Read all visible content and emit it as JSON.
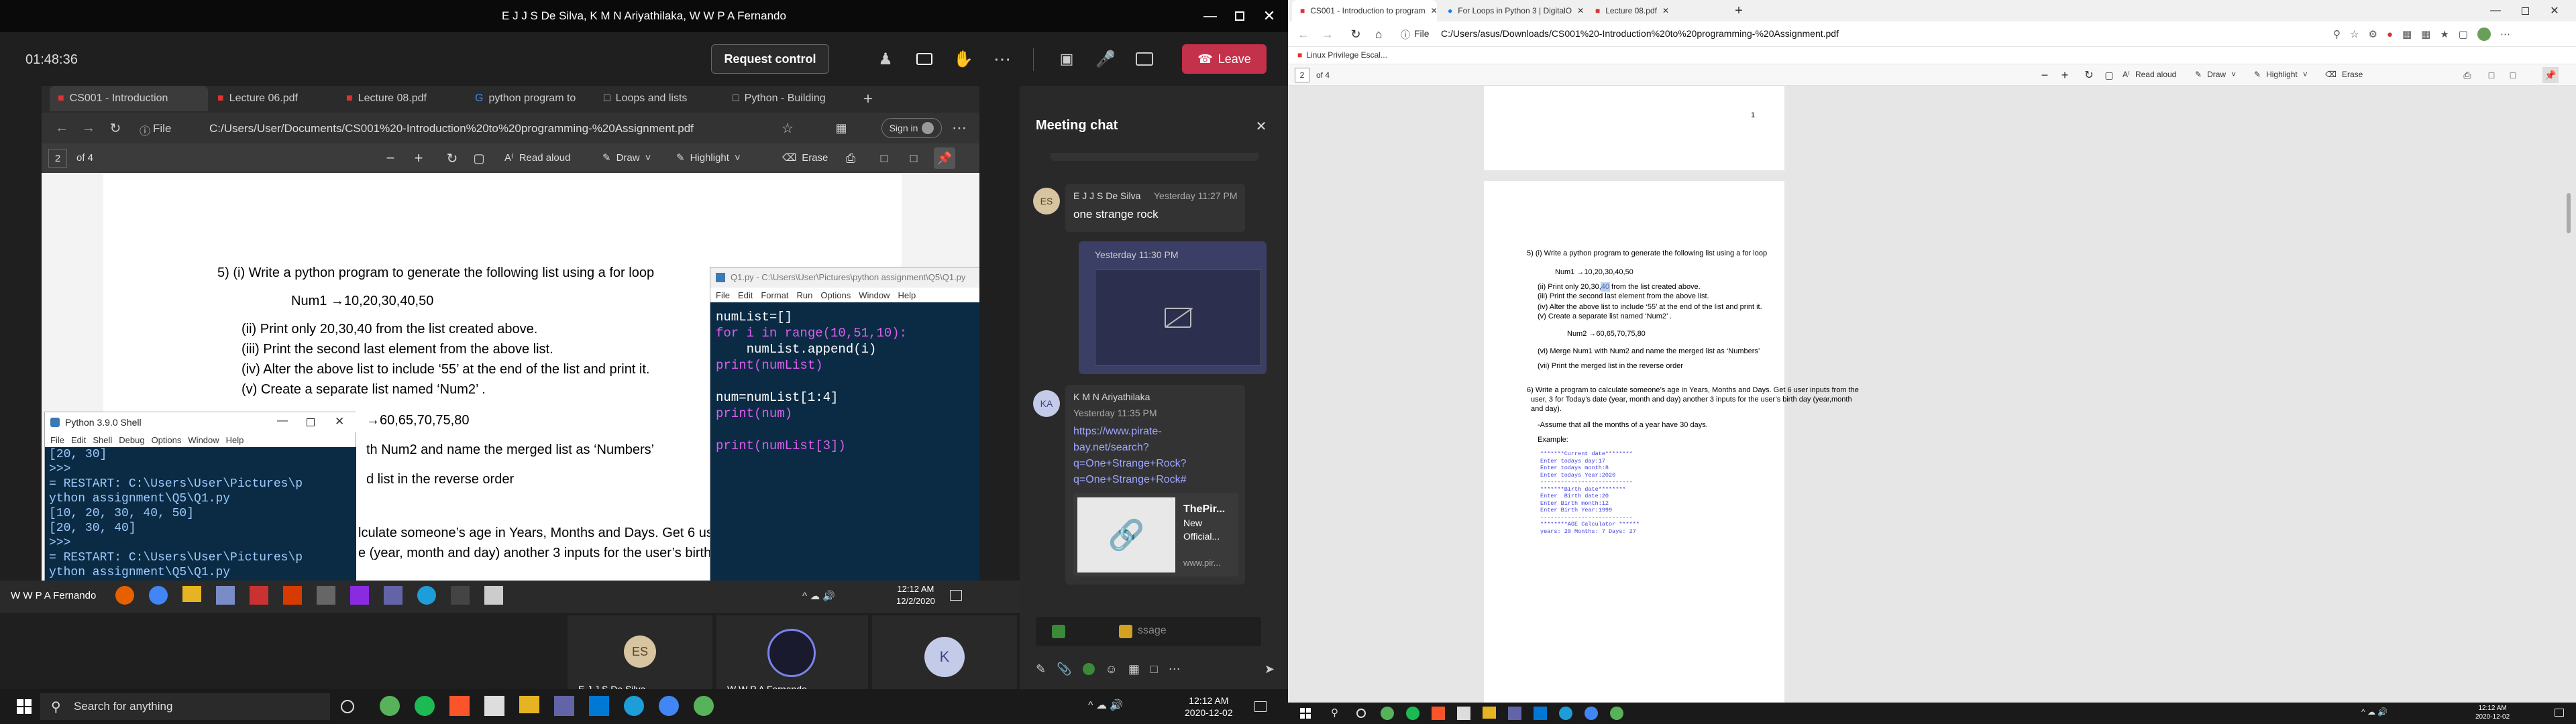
{
  "teams": {
    "title": "E J J S De Silva, K M N Ariyathilaka, W W P A Fernando",
    "timer": "01:48:36",
    "request_control": "Request control",
    "leave": "Leave",
    "chat": {
      "title": "Meeting chat",
      "messages": [
        {
          "initials": "ES",
          "author": "E J J S De Silva",
          "time": "Yesterday 11:27 PM",
          "text": "one strange rock"
        },
        {
          "time": "Yesterday 11:30 PM"
        },
        {
          "initials": "KA",
          "author": "K M N Ariyathilaka",
          "time": "Yesterday 11:35 PM",
          "link": [
            "https://www.pirate-",
            "bay.net/search?",
            "q=One+Strange+Rock?",
            "q=One+Strange+Rock#"
          ],
          "preview_title": [
            "ThePir...",
            "New",
            "Official..."
          ],
          "preview_url": "www.pir..."
        }
      ],
      "compose_placeholder": "ssage"
    },
    "participants": [
      {
        "initials": "ES",
        "name": "E J J S De Silva"
      },
      {
        "name": "W W P A Fernando"
      },
      {
        "initials": "K"
      }
    ]
  },
  "shared": {
    "tabs": [
      "CS001 - Introduction",
      "Lecture 06.pdf",
      "Lecture 08.pdf",
      "python program to",
      "Loops and lists",
      "Python - Building"
    ],
    "url_label": "File",
    "url": "C:/Users/User/Documents/CS001%20-Introduction%20to%20programming-%20Assignment.pdf",
    "sign_in": "Sign in",
    "page": "2",
    "page_of": "of 4",
    "read_aloud": "Read aloud",
    "draw": "Draw",
    "highlight": "Highlight",
    "erase": "Erase",
    "doc": {
      "q5_head": "5)    (i)  Write a python program to generate the following list using a for loop",
      "num1": "Num1 →10,20,30,40,50",
      "l2": "(ii)  Print only 20,30,40 from the list created above.",
      "l3": "(iii) Print the second last element from the above list.",
      "l4": "(iv) Alter the above list to include ‘55’ at the end of the list and print it.",
      "l5": "(v) Create a separate list named ‘Num2’ .",
      "num2": "→60,65,70,75,80",
      "l6": "th Num2 and name the merged list as ‘Numbers’",
      "l7": "d list in the reverse order",
      "l8": "lculate someone’s age in Years, Months and Days. Get 6 use",
      "l9": "e (year, month and day) another 3 inputs for the user’s birth"
    },
    "idle": {
      "title": "Q1.py - C:\\Users\\User\\Pictures\\python assignment\\Q5\\Q1.py",
      "menu": [
        "File",
        "Edit",
        "Format",
        "Run",
        "Options",
        "Window",
        "Help"
      ],
      "lines": [
        "numList=[]",
        "for i in range(10,51,10):",
        "    numList.append(i)",
        "print(numList)",
        "",
        "num=numList[1:4]",
        "print(num)",
        "",
        "print(numList[3])"
      ]
    },
    "shell": {
      "title": "Python 3.9.0 Shell",
      "menu": [
        "File",
        "Edit",
        "Shell",
        "Debug",
        "Options",
        "Window",
        "Help"
      ],
      "lines": [
        "[20, 30]",
        ">>>",
        "= RESTART: C:\\Users\\User\\Pictures\\p",
        "ython assignment\\Q5\\Q1.py",
        "[10, 20, 30, 40, 50]",
        "[20, 30, 40]",
        ">>>",
        "= RESTART: C:\\Users\\User\\Pictures\\p",
        "ython assignment\\Q5\\Q1.py"
      ]
    },
    "taskbar": {
      "user": "W W P A Fernando",
      "time": "12:12 AM",
      "date": "12/2/2020"
    }
  },
  "right_edge": {
    "tabs": [
      "CS001 - Introduction to program",
      "For Loops in Python 3 | DigitalO",
      "Lecture 08.pdf"
    ],
    "url_label": "File",
    "url": "C:/Users/asus/Downloads/CS001%20-Introduction%20to%20programming-%20Assignment.pdf",
    "bookmark": "Linux Privilege Escal...",
    "page": "2",
    "page_of": "of 4",
    "read_aloud": "Read aloud",
    "draw": "Draw",
    "highlight": "Highlight",
    "erase": "Erase",
    "page_number": "1",
    "doc": {
      "q5_head": "5)    (i)  Write a python program to generate the following list using a for loop",
      "num1": "Num1 →10,20,30,40,50",
      "l2": "(ii)  Print only 20,30,40 from the list created above.",
      "l3": "(iii) Print the second last element from the above list.",
      "l4": "(iv) Alter the above list to include ‘55’ at the end of the list and print it.",
      "l5": "(v) Create a separate list named ‘Num2’ .",
      "num2": "Num2 →60,65,70,75,80",
      "l6": "(vi) Merge Num1 with Num2 and name the merged list as ‘Numbers’",
      "l7": "(vii) Print the merged list in the reverse order",
      "q6_1": "6) Write a program to calculate someone’s age in Years, Months and Days. Get 6 user inputs from the",
      "q6_2": "user, 3 for Today’s date (year, month and day) another 3 inputs for the user’s birth day (year,month",
      "q6_3": "and day).",
      "assume": "-Assume that all the months of a year have 30 days.",
      "example": "Example:",
      "code": [
        "*******Current date********",
        "Enter todays day:17",
        "Enter todays month:8",
        "Enter todays Year:2020",
        "---------------------------",
        "*******Birth date********",
        "Enter  Birth date:20",
        "Enter Birth month:12",
        "Enter Birth Year:1999",
        "---------------------------",
        "********AGE Calculator ******",
        "years: 20 Months: 7 Days: 27"
      ]
    }
  },
  "taskbar": {
    "search_placeholder": "Search for anything",
    "left_time": "12:12 AM",
    "left_date": "2020-12-02",
    "right_time": "12:12 AM",
    "right_date": "2020-12-02"
  }
}
